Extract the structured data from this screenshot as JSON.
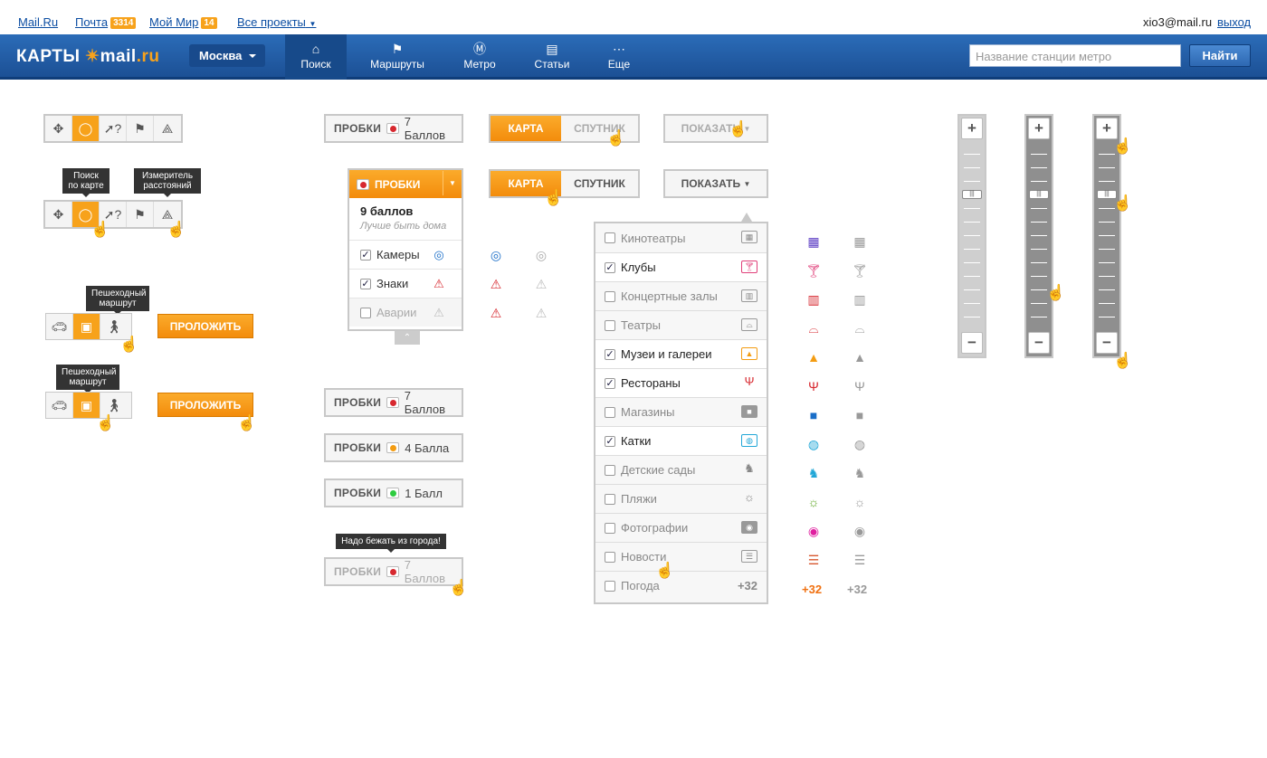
{
  "top": {
    "mailru": "Mail.Ru",
    "mail": "Почта",
    "mail_count": "3314",
    "mir": "Мой Мир",
    "mir_count": "14",
    "projects": "Все проекты",
    "user": "xio3@mail.ru",
    "logout": "выход"
  },
  "nav": {
    "logo_prefix": "КАРТЫ",
    "logo_brand": "mail",
    "logo_ru": ".ru",
    "city": "Москва",
    "items": [
      "Поиск",
      "Маршруты",
      "Метро",
      "Статьи",
      "Еще"
    ],
    "search_placeholder": "Название станции метро",
    "find": "Найти"
  },
  "tooltips": {
    "search": "Поиск\nпо карте",
    "measure": "Измеритель\nрасстояний",
    "walk1": "Пешеходный\nмаршрут",
    "walk2": "Пешеходный\nмаршрут",
    "run": "Надо бежать из города!"
  },
  "route_btn": "ПРОЛОЖИТЬ",
  "traffic_btns": [
    {
      "label": "ПРОБКИ",
      "value": "7 Баллов",
      "color": "#d7282f"
    },
    {
      "label": "ПРОБКИ",
      "value": "7 Баллов",
      "color": "#d7282f"
    },
    {
      "label": "ПРОБКИ",
      "value": "4 Балла",
      "color": "#f39c12"
    },
    {
      "label": "ПРОБКИ",
      "value": "1 Балл",
      "color": "#2ecc40"
    },
    {
      "label": "ПРОБКИ",
      "value": "7 Баллов",
      "color": "#d7282f"
    }
  ],
  "traffic_panel": {
    "header": "ПРОБКИ",
    "score": "9 баллов",
    "hint": "Лучше быть дома",
    "rows": [
      {
        "label": "Камеры",
        "checked": true
      },
      {
        "label": "Знаки",
        "checked": true
      },
      {
        "label": "Аварии",
        "checked": false
      }
    ]
  },
  "maptype": {
    "map": "КАРТА",
    "sat": "СПУТНИК"
  },
  "show": "ПОКАЗАТЬ",
  "poi": [
    {
      "label": "Кинотеатры",
      "checked": false
    },
    {
      "label": "Клубы",
      "checked": true
    },
    {
      "label": "Концертные залы",
      "checked": false
    },
    {
      "label": "Театры",
      "checked": false
    },
    {
      "label": "Музеи и галереи",
      "checked": true
    },
    {
      "label": "Рестораны",
      "checked": true
    },
    {
      "label": "Магазины",
      "checked": false
    },
    {
      "label": "Катки",
      "checked": true
    },
    {
      "label": "Детские сады",
      "checked": false
    },
    {
      "label": "Пляжи",
      "checked": false
    },
    {
      "label": "Фотографии",
      "checked": false
    },
    {
      "label": "Новости",
      "checked": false
    },
    {
      "label": "Погода",
      "checked": false
    }
  ],
  "weather": "+32",
  "icons": {
    "checks": "✓"
  }
}
